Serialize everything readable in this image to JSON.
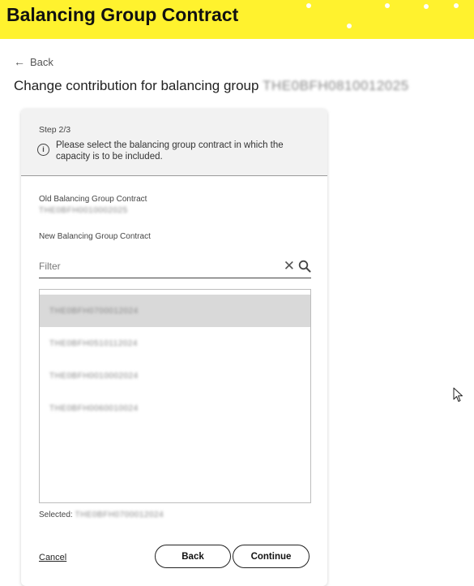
{
  "banner": {
    "title": "Balancing Group Contract",
    "color": "#fff22e"
  },
  "nav": {
    "back_label": "Back"
  },
  "page": {
    "title_prefix": "Change contribution for balancing group",
    "title_group_id": "THE0BFH0810012025"
  },
  "card": {
    "step": "Step 2/3",
    "info_text": "Please select the balancing group contract in which the capacity is to be included.",
    "old_contract_label": "Old Balancing Group Contract",
    "old_contract_value": "THE0BFH0010002025",
    "new_contract_label": "New Balancing Group Contract",
    "filter": {
      "placeholder": "Filter",
      "value": ""
    },
    "contracts": [
      {
        "id": "THE0BFH0700012024",
        "selected": true
      },
      {
        "id": "THE0BFH0510112024",
        "selected": false
      },
      {
        "id": "THE0BFH0010002024",
        "selected": false
      },
      {
        "id": "THE0BFH0060010024",
        "selected": false
      }
    ],
    "selected_label": "Selected:",
    "selected_value": "THE0BFH0700012024",
    "cancel_label": "Cancel",
    "back_button_label": "Back",
    "continue_button_label": "Continue"
  }
}
